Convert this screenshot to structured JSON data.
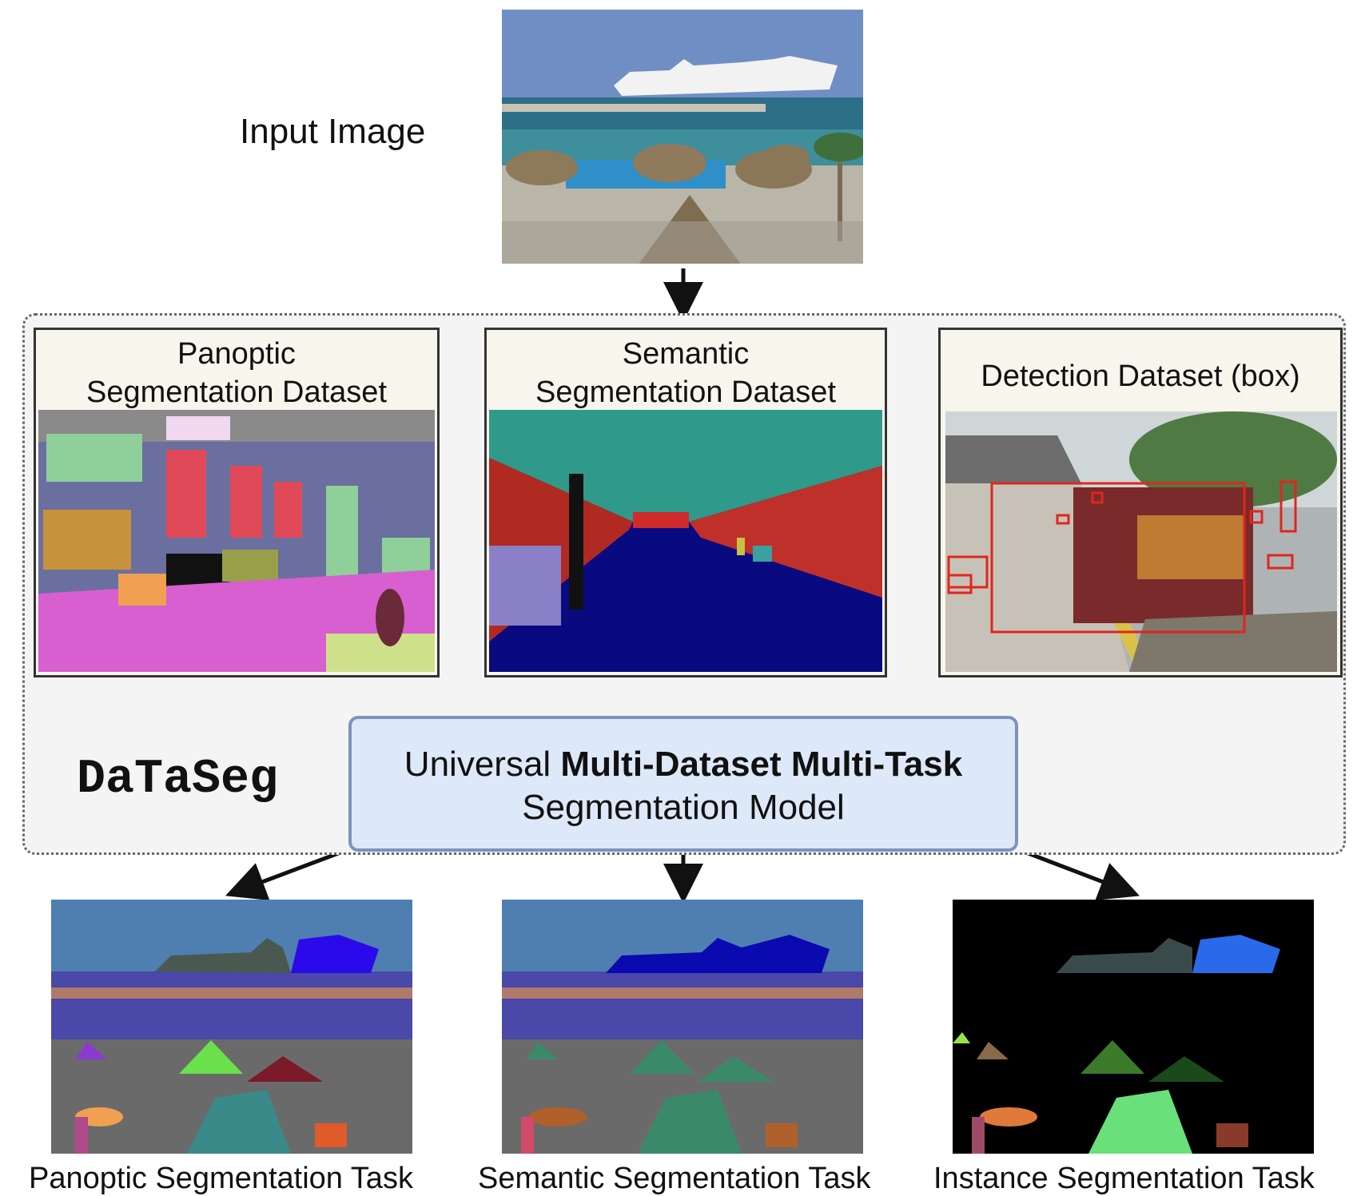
{
  "input": {
    "label": "Input Image"
  },
  "datasets": [
    {
      "title_line1": "Panoptic",
      "title_line2": "Segmentation Dataset"
    },
    {
      "title_line1": "Semantic",
      "title_line2": "Segmentation Dataset"
    },
    {
      "title_line1": "Detection Dataset (box)",
      "title_line2": ""
    }
  ],
  "framework": {
    "name": "DaTaSeg"
  },
  "model": {
    "prefix": "Universal ",
    "bold": "Multi-Dataset Multi-Task",
    "line2": "Segmentation Model"
  },
  "outputs": [
    {
      "label": "Panoptic Segmentation Task"
    },
    {
      "label": "Semantic Segmentation Task"
    },
    {
      "label": "Instance Segmentation Task"
    }
  ],
  "colors": {
    "arrow": "#111111",
    "model_fill": "#dde8f8",
    "model_border": "#7b93bd",
    "detection_box": "#e0261c"
  }
}
